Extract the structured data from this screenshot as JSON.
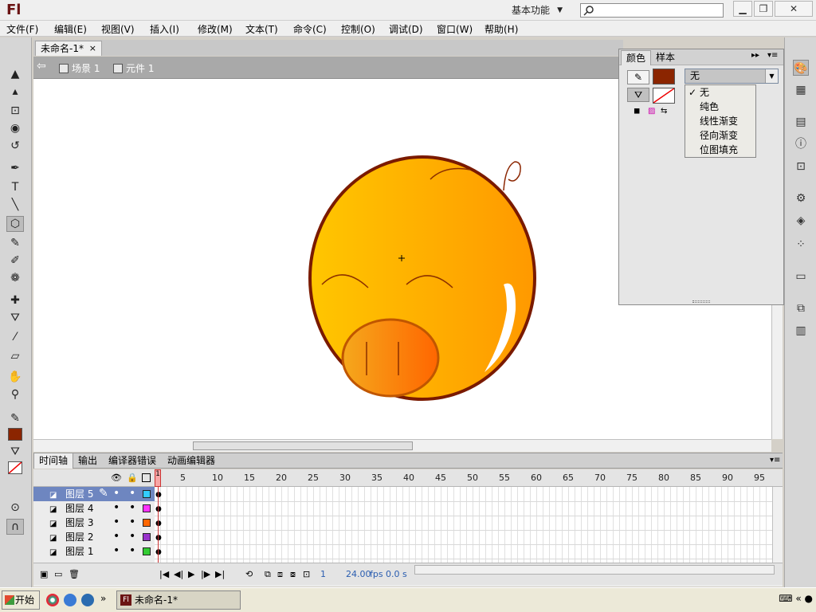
{
  "app": {
    "logo": "Fl",
    "workspace": "基本功能",
    "search_placeholder": ""
  },
  "window_buttons": {
    "minimize": "▁",
    "restore": "❐",
    "close": "✕"
  },
  "menu": [
    "文件(F)",
    "编辑(E)",
    "视图(V)",
    "插入(I)",
    "修改(M)",
    "文本(T)",
    "命令(C)",
    "控制(O)",
    "调试(D)",
    "窗口(W)",
    "帮助(H)"
  ],
  "document": {
    "tab_label": "未命名-1*",
    "close": "×"
  },
  "scene": {
    "back": "⇦",
    "scene_label": "场景 1",
    "symbol_label": "元件 1"
  },
  "stage": {
    "background": "#ffffff",
    "drawing": "pig-face"
  },
  "tools": {
    "selection": "▲",
    "subselection": "▴",
    "free-transform": "⊡",
    "3d-rotation": "◉",
    "lasso": "↺",
    "pen": "✒",
    "text": "T",
    "line": "╲",
    "rectangle": "⬡",
    "pencil": "✎",
    "brush": "✐",
    "deco": "❁",
    "bone": "✚",
    "paint-bucket": "⛛",
    "eyedropper": "⁄",
    "eraser": "▱",
    "hand": "✋",
    "zoom": "⚲",
    "stroke-color-label": "✎",
    "stroke_color": "#8b2500",
    "fill-icon": "⛛",
    "snap": "⊙",
    "magnet": "∩"
  },
  "color_panel": {
    "tabs": [
      "颜色",
      "样本"
    ],
    "stroke_color": "#8b2500",
    "fill_color": "none",
    "type_select": "无",
    "type_options": [
      "无",
      "纯色",
      "线性渐变",
      "径向渐变",
      "位图填充"
    ],
    "collapse": "▸▸",
    "menu": "▾≡"
  },
  "timeline": {
    "tabs": [
      "时间轴",
      "输出",
      "编译器错误",
      "动画编辑器"
    ],
    "ruler": [
      "1",
      "5",
      "10",
      "15",
      "20",
      "25",
      "30",
      "35",
      "40",
      "45",
      "50",
      "55",
      "60",
      "65",
      "70",
      "75",
      "80",
      "85",
      "90",
      "95"
    ],
    "layers": [
      {
        "name": "图层 5",
        "color": "#33ccff",
        "selected": true
      },
      {
        "name": "图层 4",
        "color": "#ff33ff",
        "selected": false
      },
      {
        "name": "图层 3",
        "color": "#ff6600",
        "selected": false
      },
      {
        "name": "图层 2",
        "color": "#9933cc",
        "selected": false
      },
      {
        "name": "图层 1",
        "color": "#33cc33",
        "selected": false
      }
    ],
    "current_frame": "1",
    "fps": "24.00",
    "fps_unit": "fps",
    "time": "0.0 s"
  },
  "taskbar": {
    "start": "开始",
    "task": "未命名-1*",
    "task_icon": "Fl",
    "more": "»",
    "tray": "⌨ « ●"
  }
}
